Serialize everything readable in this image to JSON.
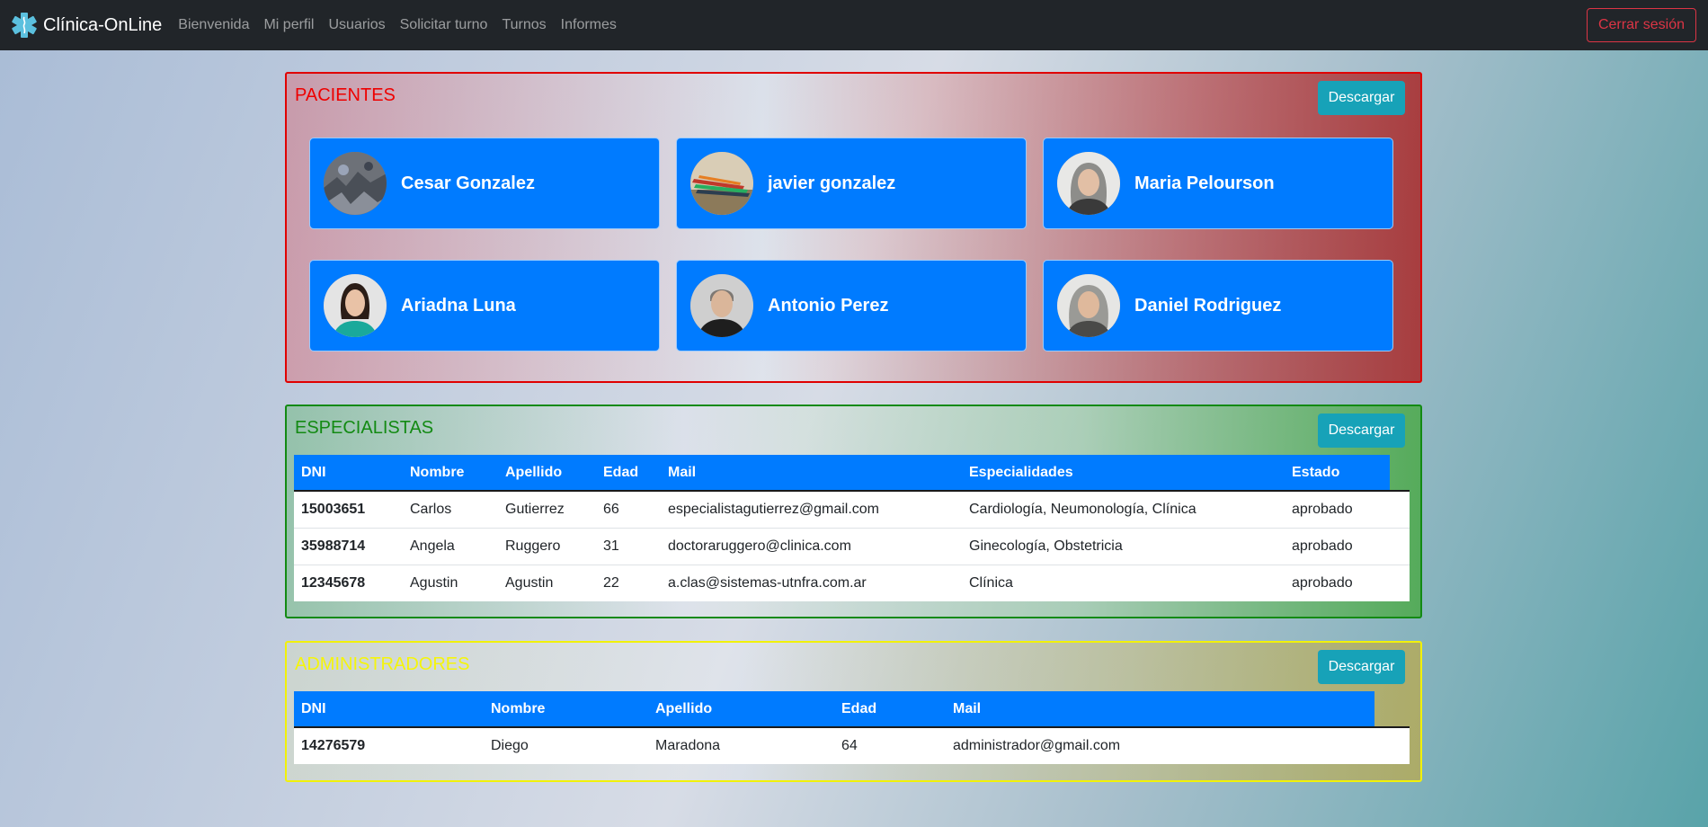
{
  "nav": {
    "brand": "Clínica-OnLine",
    "links": [
      "Bienvenida",
      "Mi perfil",
      "Usuarios",
      "Solicitar turno",
      "Turnos",
      "Informes"
    ],
    "logout": "Cerrar sesión"
  },
  "pacientes": {
    "title": "PACIENTES",
    "download": "Descargar",
    "cards": [
      {
        "name": "Cesar Gonzalez"
      },
      {
        "name": "javier gonzalez"
      },
      {
        "name": "Maria Pelourson"
      },
      {
        "name": "Ariadna Luna"
      },
      {
        "name": "Antonio Perez"
      },
      {
        "name": "Daniel Rodriguez"
      }
    ]
  },
  "especialistas": {
    "title": "ESPECIALISTAS",
    "download": "Descargar",
    "columns": [
      "DNI",
      "Nombre",
      "Apellido",
      "Edad",
      "Mail",
      "Especialidades",
      "Estado"
    ],
    "rows": [
      [
        "15003651",
        "Carlos",
        "Gutierrez",
        "66",
        "especialistagutierrez@gmail.com",
        "Cardiología, Neumonología, Clínica",
        "aprobado"
      ],
      [
        "35988714",
        "Angela",
        "Ruggero",
        "31",
        "doctoraruggero@clinica.com",
        "Ginecología, Obstetricia",
        "aprobado"
      ],
      [
        "12345678",
        "Agustin",
        "Agustin",
        "22",
        "a.clas@sistemas-utnfra.com.ar",
        "Clínica",
        "aprobado"
      ]
    ]
  },
  "administradores": {
    "title": "ADMINISTRADORES",
    "download": "Descargar",
    "columns": [
      "DNI",
      "Nombre",
      "Apellido",
      "Edad",
      "Mail"
    ],
    "rows": [
      [
        "14276579",
        "Diego",
        "Maradona",
        "64",
        "administrador@gmail.com"
      ]
    ]
  },
  "colors": {
    "navbar": "#212529",
    "primary": "#007bff",
    "info": "#17a2b8",
    "danger": "#dc3545",
    "pacientes_border": "#e00000",
    "especialistas_border": "#138a13",
    "administradores_border": "#f1f10a"
  }
}
